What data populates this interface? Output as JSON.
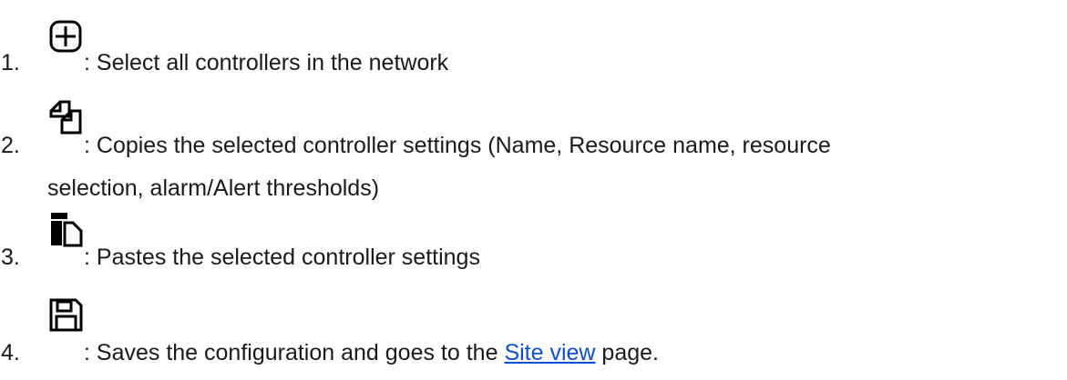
{
  "items": [
    {
      "number": "1.",
      "icon": "select-all-plus-icon",
      "text": ": Select all controllers in the network"
    },
    {
      "number": "2.",
      "icon": "copy-icon",
      "text": ": Copies the selected controller settings (Name, Resource name, resource",
      "text_continued": "selection, alarm/Alert thresholds)"
    },
    {
      "number": "3.",
      "icon": "paste-icon",
      "text": ": Pastes the selected controller settings"
    },
    {
      "number": "4.",
      "icon": "save-floppy-icon",
      "text_before_link": ": Saves the configuration and goes to the ",
      "link_text": "Site view",
      "text_after_link": " page."
    }
  ],
  "colors": {
    "text": "#1a1a1a",
    "link": "#0b4fd6",
    "icon": "#000000"
  }
}
